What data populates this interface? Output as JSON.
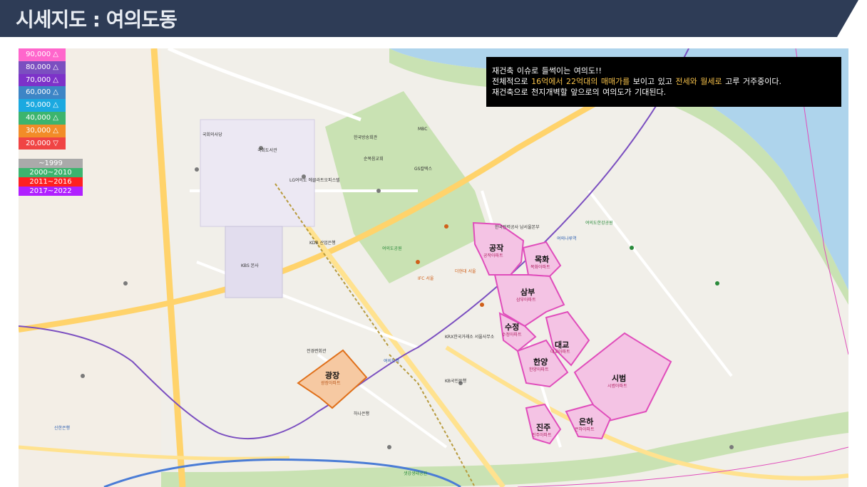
{
  "page": {
    "title": "시세지도 : 여의도동",
    "colors": {
      "header": "#2e3c56",
      "water": "#aed4ec",
      "park": "#c9e2b3",
      "zone_fill": "#f4c3e4",
      "zone_border": "#e04dbb",
      "plaza_fill": "#f6c9a2",
      "plaza_border": "#e0701a"
    }
  },
  "legend_price": [
    {
      "label": "90,000 △",
      "color": "#ff66cc"
    },
    {
      "label": "80,000 △",
      "color": "#7b4fc0"
    },
    {
      "label": "70,000 △",
      "color": "#7d32c9"
    },
    {
      "label": "60,000 △",
      "color": "#3d85c6"
    },
    {
      "label": "50,000 △",
      "color": "#1ba9e0"
    },
    {
      "label": "40,000 △",
      "color": "#3cb46e"
    },
    {
      "label": "30,000 △",
      "color": "#f28c28"
    },
    {
      "label": "20,000 ▽",
      "color": "#f04444"
    }
  ],
  "legend_year": [
    {
      "label": "~1999",
      "color": "#aaaaaa"
    },
    {
      "label": "2000~2010",
      "color": "#3cb46e"
    },
    {
      "label": "2011~2016",
      "color": "#ff2020"
    },
    {
      "label": "2017~2022",
      "color": "#b020ff"
    }
  ],
  "info": {
    "line1": "재건축 이슈로 들썩이는 여의도!!",
    "line2_a": "전체적으로 ",
    "line2_b": "16억에서 22억대의 매매가를",
    "line2_c": " 보이고 있고 ",
    "line2_d": "전세와 월세로",
    "line2_e": " 고루 거주중이다.",
    "line3": "재건축으로 천지개벽할 앞으로의 여의도가 기대된다."
  },
  "zones": {
    "gongjak": {
      "name": "공작",
      "sub": "공작아파트"
    },
    "mokhwa": {
      "name": "목화",
      "sub": "목화아파트"
    },
    "sambu": {
      "name": "삼부",
      "sub": "삼부아파트"
    },
    "sujeong": {
      "name": "수정",
      "sub": "수정아파트"
    },
    "daegyo": {
      "name": "대교",
      "sub": "대교아파트"
    },
    "hanyang": {
      "name": "한양",
      "sub": "한양아파트"
    },
    "sibeom": {
      "name": "시범",
      "sub": "시범아파트"
    },
    "jinju": {
      "name": "진주",
      "sub": "진주아파트"
    },
    "eunha": {
      "name": "은하",
      "sub": "은하아파트"
    },
    "gwangjang": {
      "name": "광장",
      "sub": "광장아파트"
    }
  },
  "places": {
    "national_assembly": "국회의사당",
    "assembly_library": "국회도서관",
    "kbs": "KBS 본사",
    "lg": "LG여의도 에클라트오피스텔",
    "hyundai": "더현대 서울",
    "ifc": "IFC 서울",
    "krx": "KRX한국거래소 서울사무소",
    "kdb": "KDB 산업은행",
    "park": "여의도공원",
    "hangang_park": "여의도한강공원",
    "saetgang": "샛강생태공원",
    "yeouido_station": "여의도역",
    "yeouinaru": "여의나루역",
    "pyeongtaek": "한국전력공사 남서울본부",
    "sinhan": "신한은행",
    "kb": "KB국민은행",
    "hana": "하나은행",
    "broadcast": "한국방송회관",
    "gs": "GS칼텍스",
    "jeonkyung": "전경련회관",
    "mbc": "MBC",
    "sunwoo": "순복음교회"
  }
}
